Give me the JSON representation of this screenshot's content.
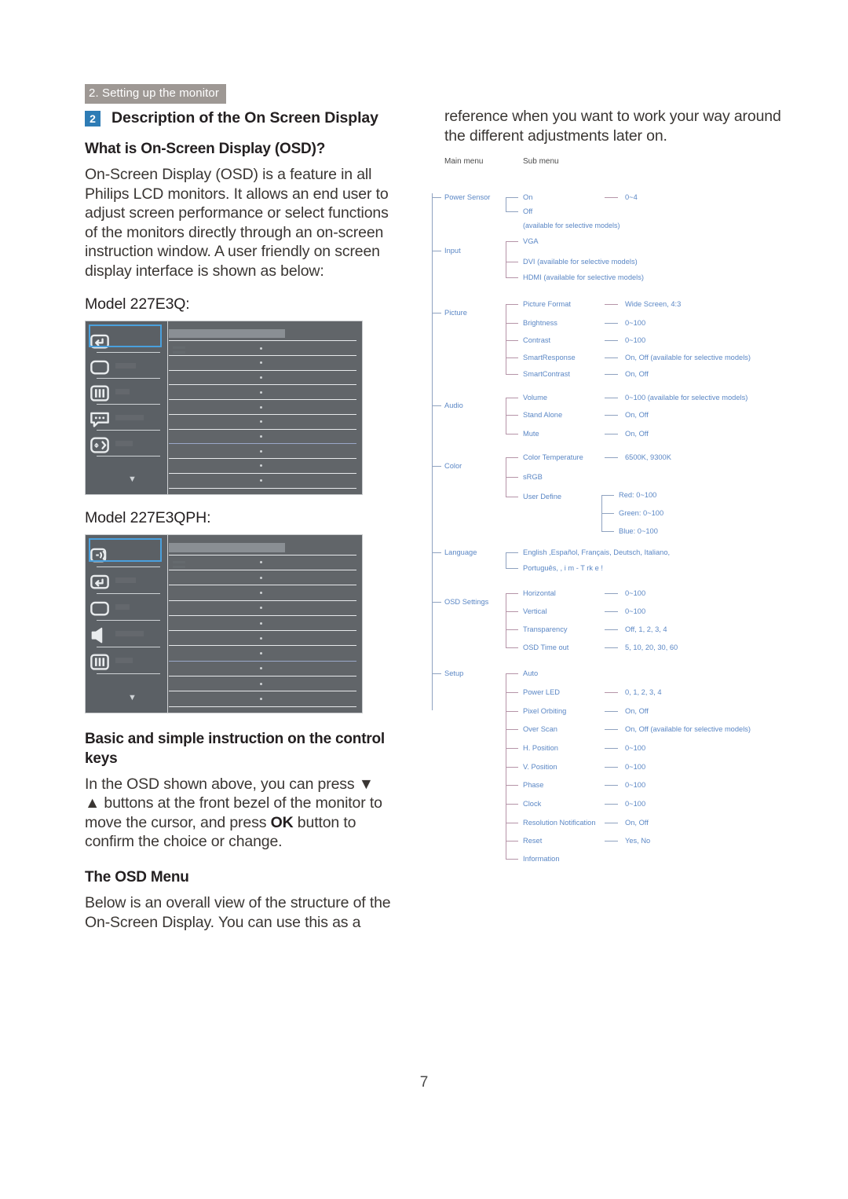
{
  "running_header": "2. Setting up the monitor",
  "section": {
    "badge": "2",
    "title": "Description of the On Screen Display"
  },
  "headings": {
    "what_is_osd": "What is On-Screen Display (OSD)?",
    "control_keys": "Basic and simple instruction on the control keys",
    "osd_menu": "The OSD Menu"
  },
  "paragraphs": {
    "osd_intro": "On-Screen Display (OSD) is a feature in all Philips LCD monitors. It allows an end user to adjust screen performance or select functions of the monitors directly through an on-screen instruction window. A user friendly on screen display interface is shown as below:",
    "control_keys_1": "In the OSD shown above, you can press ▼ ▲ buttons at the front bezel of the monitor to move the cursor, and press ",
    "control_keys_ok": "OK",
    "control_keys_2": " button to confirm the choice or change.",
    "osd_menu_1": "Below is an overall view of the structure of the On-Screen Display. You can use this as a",
    "osd_menu_2": "reference when you want to work your way around the different adjustments later on."
  },
  "models": {
    "model_1": "Model 227E3Q:",
    "model_2": "Model 227E3QPH:"
  },
  "osd_mock_1": {
    "icons": [
      "input-return-icon",
      "picture-frame-icon",
      "contrast-bars-icon",
      "language-bubble-icon",
      "osd-settings-arrows-icon"
    ],
    "scroll_caret": "▼",
    "selected_index": 0
  },
  "osd_mock_2": {
    "icons": [
      "power-sensor-icon",
      "input-return-icon",
      "picture-frame-icon",
      "audio-speaker-icon",
      "contrast-bars-icon"
    ],
    "scroll_caret": "▼",
    "selected_index": 0
  },
  "tree": {
    "col_main": "Main menu",
    "col_sub": "Sub menu",
    "groups": [
      {
        "name": "Power Sensor",
        "items": [
          {
            "label": "On",
            "values": "0~4"
          },
          {
            "label": "Off",
            "values": ""
          },
          {
            "label": "(available for selective models)",
            "values": "",
            "note": true
          }
        ]
      },
      {
        "name": "Input",
        "items": [
          {
            "label": "VGA",
            "values": ""
          },
          {
            "label": "DVI (available for selective models)",
            "values": ""
          },
          {
            "label": "HDMI (available for selective models)",
            "values": ""
          }
        ]
      },
      {
        "name": "Picture",
        "items": [
          {
            "label": "Picture Format",
            "values": "Wide Screen, 4:3"
          },
          {
            "label": "Brightness",
            "values": "0~100"
          },
          {
            "label": "Contrast",
            "values": "0~100"
          },
          {
            "label": "SmartResponse",
            "values": "On, Off (available for selective models)"
          },
          {
            "label": "SmartContrast",
            "values": "On, Off"
          }
        ]
      },
      {
        "name": "Audio",
        "items": [
          {
            "label": "Volume",
            "values": "0~100 (available for selective models)"
          },
          {
            "label": "Stand Alone",
            "values": "On, Off"
          },
          {
            "label": "Mute",
            "values": "On, Off"
          }
        ]
      },
      {
        "name": "Color",
        "items": [
          {
            "label": "Color Temperature",
            "values": "6500K, 9300K"
          },
          {
            "label": "sRGB",
            "values": ""
          },
          {
            "label": "User Define",
            "values": ""
          }
        ],
        "subitems": [
          "Red: 0~100",
          "Green: 0~100",
          "Blue: 0~100"
        ]
      },
      {
        "name": "Language",
        "items": [
          {
            "label": "English ,Español, Français, Deutsch, Italiano,",
            "values": ""
          },
          {
            "label": "Português,          ,     i m -   T rk e  !",
            "values": ""
          }
        ]
      },
      {
        "name": "OSD Settings",
        "items": [
          {
            "label": "Horizontal",
            "values": "0~100"
          },
          {
            "label": "Vertical",
            "values": "0~100"
          },
          {
            "label": "Transparency",
            "values": "Off, 1, 2, 3, 4"
          },
          {
            "label": "OSD Time out",
            "values": "5, 10, 20, 30, 60"
          }
        ]
      },
      {
        "name": "Setup",
        "items": [
          {
            "label": "Auto",
            "values": ""
          },
          {
            "label": "Power LED",
            "values": "0, 1, 2, 3, 4"
          },
          {
            "label": "Pixel Orbiting",
            "values": "On, Off"
          },
          {
            "label": "Over Scan",
            "values": "On, Off (available for selective models)"
          },
          {
            "label": "H. Position",
            "values": "0~100"
          },
          {
            "label": "V. Position",
            "values": "0~100"
          },
          {
            "label": "Phase",
            "values": "0~100"
          },
          {
            "label": "Clock",
            "values": "0~100"
          },
          {
            "label": "Resolution Notification",
            "values": "On, Off"
          },
          {
            "label": "Reset",
            "values": "Yes, No"
          },
          {
            "label": "Information",
            "values": ""
          }
        ]
      }
    ]
  },
  "page_number": "7",
  "colors": {
    "accent_blue": "#2e7cb5",
    "tree_text": "#5b87c5",
    "tree_line_blue": "#8fa2c0",
    "tree_line_mauve": "#b594a8",
    "header_bg": "#9e9894",
    "osd_bg": "#5b5f63",
    "osd_select": "#4aa0dd"
  }
}
